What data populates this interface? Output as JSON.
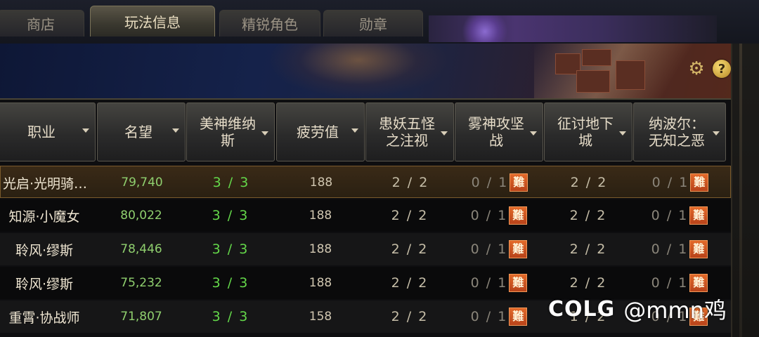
{
  "tabs": [
    {
      "label": "商店",
      "active": false
    },
    {
      "label": "玩法信息",
      "active": true
    },
    {
      "label": "精锐角色",
      "active": false
    },
    {
      "label": "勋章",
      "active": false
    }
  ],
  "toolbar": {
    "settings_icon": "gear-icon",
    "help_icon": "question-icon",
    "help_glyph": "?"
  },
  "columns": [
    {
      "label": "职业",
      "sortable": true
    },
    {
      "label": "名望",
      "sortable": true
    },
    {
      "label": "美神维纳斯",
      "sortable": true
    },
    {
      "label": "疲劳值",
      "sortable": true
    },
    {
      "label": "患妖五怪之注视",
      "sortable": true
    },
    {
      "label": "雾神攻坚战",
      "sortable": true
    },
    {
      "label": "征讨地下城",
      "sortable": true
    },
    {
      "label": "纳波尔：无知之恶",
      "sortable": true
    }
  ],
  "header_lines": [
    [
      "职业"
    ],
    [
      "名望"
    ],
    [
      "美神维纳",
      "斯"
    ],
    [
      "疲劳值"
    ],
    [
      "患妖五怪",
      "之注视"
    ],
    [
      "雾神攻坚",
      "战"
    ],
    [
      "征讨地下",
      "城"
    ],
    [
      "纳波尔：",
      "无知之恶"
    ]
  ],
  "hard_badge": "難",
  "rows": [
    {
      "job": "光启·光明骑…",
      "fame": "79,740",
      "venus": "3 / 3",
      "fatigue": "188",
      "yaoguai": "2 / 2",
      "mist": "0 / 1",
      "dungeon": "2 / 2",
      "napol": "0 / 1",
      "selected": true
    },
    {
      "job": "知源·小魔女",
      "fame": "80,022",
      "venus": "3 / 3",
      "fatigue": "188",
      "yaoguai": "2 / 2",
      "mist": "0 / 1",
      "dungeon": "2 / 2",
      "napol": "0 / 1",
      "selected": false
    },
    {
      "job": "聆风·缪斯",
      "fame": "78,446",
      "venus": "3 / 3",
      "fatigue": "188",
      "yaoguai": "2 / 2",
      "mist": "0 / 1",
      "dungeon": "2 / 2",
      "napol": "0 / 1",
      "selected": false
    },
    {
      "job": "聆风·缪斯",
      "fame": "75,232",
      "venus": "3 / 3",
      "fatigue": "188",
      "yaoguai": "2 / 2",
      "mist": "0 / 1",
      "dungeon": "2 / 2",
      "napol": "0 / 1",
      "selected": false
    },
    {
      "job": "重霄·协战师",
      "fame": "71,807",
      "venus": "3 / 3",
      "fatigue": "158",
      "yaoguai": "2 / 2",
      "mist": "0 / 1",
      "dungeon": "1 / 2",
      "napol": "0 / 1",
      "selected": false
    }
  ],
  "watermark": {
    "logo": "COLG",
    "handle": "@mmn鸡"
  },
  "colors": {
    "accent_gold": "#d4b668",
    "value_green": "#64d84a",
    "hard_orange": "#c9521f"
  }
}
